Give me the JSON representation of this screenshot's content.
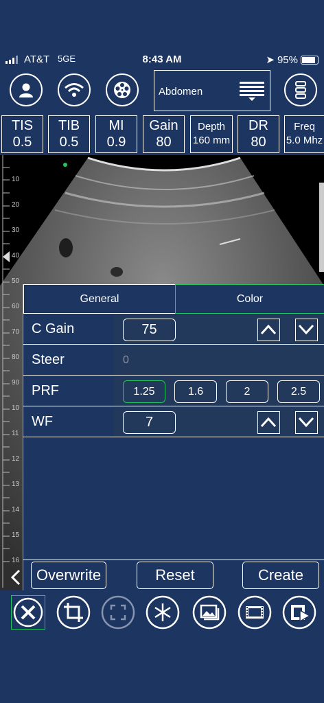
{
  "status": {
    "carrier": "AT&T",
    "network": "5GE",
    "time": "8:43 AM",
    "battery": "95%"
  },
  "preset": {
    "label": "Abdomen"
  },
  "top_icons": [
    "patient-icon",
    "wifi-icon",
    "film-reel-icon",
    "menu-icon"
  ],
  "params": [
    {
      "title": "TIS",
      "value": "0.5"
    },
    {
      "title": "TIB",
      "value": "0.5"
    },
    {
      "title": "MI",
      "value": "0.9"
    },
    {
      "title": "Gain",
      "value": "80"
    },
    {
      "title": "Depth",
      "value": "160 mm"
    },
    {
      "title": "DR",
      "value": "80"
    },
    {
      "title": "Freq",
      "value": "5.0 Mhz"
    }
  ],
  "ruler": {
    "labels": [
      "10",
      "20",
      "30",
      "40",
      "50",
      "60",
      "70",
      "80",
      "90",
      "10",
      "11",
      "12",
      "13",
      "14",
      "15",
      "16"
    ]
  },
  "panel": {
    "tabs": {
      "general": "General",
      "color": "Color"
    },
    "c_gain": {
      "label": "C Gain",
      "value": "75"
    },
    "steer": {
      "label": "Steer",
      "value": "0"
    },
    "prf": {
      "label": "PRF",
      "options": [
        "1.25",
        "1.6",
        "2",
        "2.5"
      ],
      "selected": "1.25"
    },
    "wf": {
      "label": "WF",
      "value": "7"
    }
  },
  "buttons": {
    "overwrite": "Overwrite",
    "reset": "Reset",
    "create": "Create"
  },
  "toolbar": [
    "tools-icon",
    "crop-icon",
    "fullscreen-icon",
    "freeze-icon",
    "image-gallery-icon",
    "video-icon",
    "video-play-icon"
  ],
  "colors": {
    "background": "#1d3561",
    "selected": "#22c55e"
  }
}
